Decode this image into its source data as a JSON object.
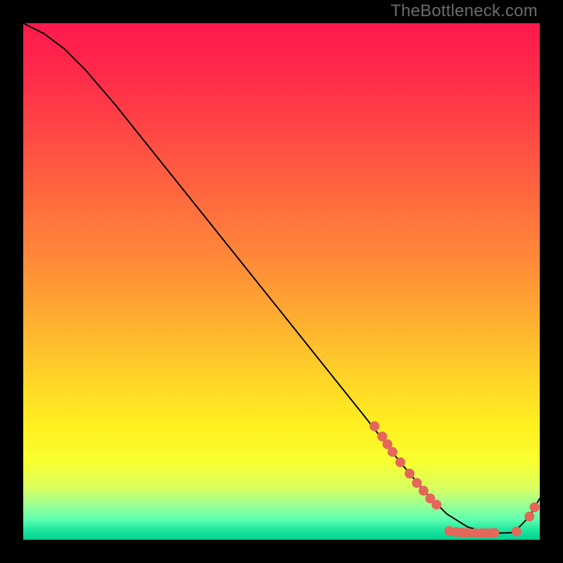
{
  "watermark": "TheBottleneck.com",
  "chart_data": {
    "type": "line",
    "title": "",
    "xlabel": "",
    "ylabel": "",
    "xlim": [
      0,
      100
    ],
    "ylim": [
      0,
      100
    ],
    "curve": {
      "x": [
        0,
        4,
        8,
        12,
        18,
        26,
        34,
        42,
        50,
        58,
        66,
        73,
        78,
        82,
        86,
        89,
        92,
        95,
        98,
        100
      ],
      "y": [
        100,
        98,
        95,
        91,
        84,
        74,
        64,
        54,
        44,
        34,
        24,
        15,
        9,
        5,
        2.5,
        1.6,
        1.3,
        1.4,
        4.5,
        8
      ]
    },
    "points": {
      "color": "#e4675a",
      "radius_px": 7,
      "items": [
        {
          "x": 68.0,
          "y": 22.0
        },
        {
          "x": 69.5,
          "y": 20.0
        },
        {
          "x": 70.5,
          "y": 18.5
        },
        {
          "x": 71.5,
          "y": 17.0
        },
        {
          "x": 73.0,
          "y": 15.0
        },
        {
          "x": 74.8,
          "y": 12.8
        },
        {
          "x": 76.2,
          "y": 11.0
        },
        {
          "x": 77.5,
          "y": 9.5
        },
        {
          "x": 78.8,
          "y": 8.0
        },
        {
          "x": 80.0,
          "y": 6.8
        },
        {
          "x": 82.5,
          "y": 1.7
        },
        {
          "x": 83.8,
          "y": 1.5
        },
        {
          "x": 85.0,
          "y": 1.4
        },
        {
          "x": 86.0,
          "y": 1.35
        },
        {
          "x": 87.5,
          "y": 1.3
        },
        {
          "x": 88.8,
          "y": 1.3
        },
        {
          "x": 90.0,
          "y": 1.3
        },
        {
          "x": 91.2,
          "y": 1.35
        },
        {
          "x": 95.5,
          "y": 1.6
        },
        {
          "x": 98.0,
          "y": 4.5
        },
        {
          "x": 99.0,
          "y": 6.3
        }
      ]
    }
  }
}
